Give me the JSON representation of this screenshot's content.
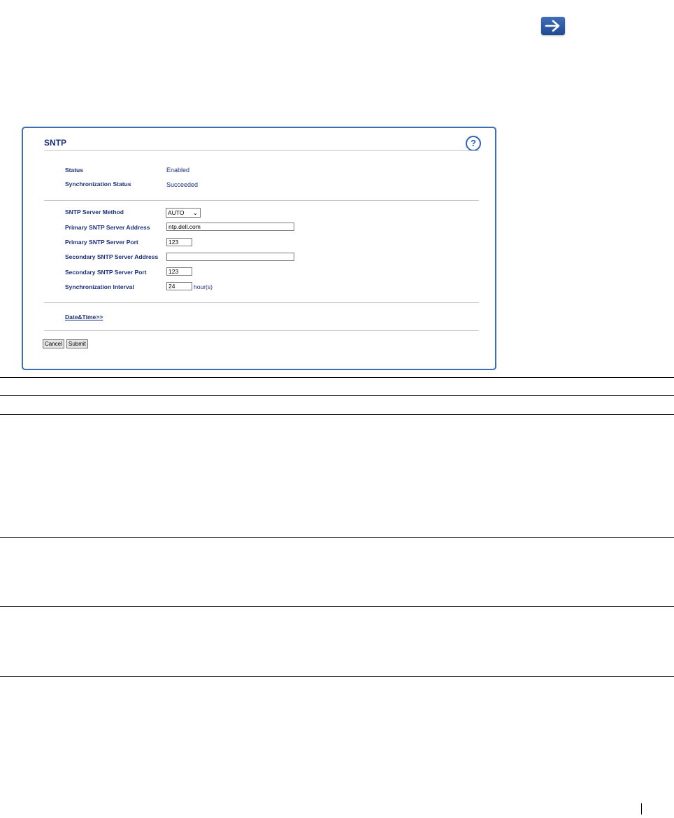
{
  "panel": {
    "title": "SNTP",
    "help_icon": "question-mark-icon",
    "status_label": "Status",
    "status_value": "Enabled",
    "sync_status_label": "Synchronization Status",
    "sync_status_value": "Succeeded",
    "method_label": "SNTP Server Method",
    "method_value": "AUTO",
    "primary_address_label": "Primary SNTP Server Address",
    "primary_address_value": "ntp.dell.com",
    "primary_port_label": "Primary SNTP Server Port",
    "primary_port_value": "123",
    "secondary_address_label": "Secondary SNTP Server Address",
    "secondary_address_value": "",
    "secondary_port_label": "Secondary SNTP Server Port",
    "secondary_port_value": "123",
    "interval_label": "Synchronization Interval",
    "interval_value": "24",
    "interval_unit": "hour(s)",
    "datetime_link": "Date&Time>>",
    "cancel_label": "Cancel",
    "submit_label": "Submit"
  },
  "icons": {
    "next": "arrow-right-icon",
    "help": "help-icon"
  },
  "colors": {
    "accent": "#1b2f7d",
    "panel_border": "#3a6fb5"
  }
}
